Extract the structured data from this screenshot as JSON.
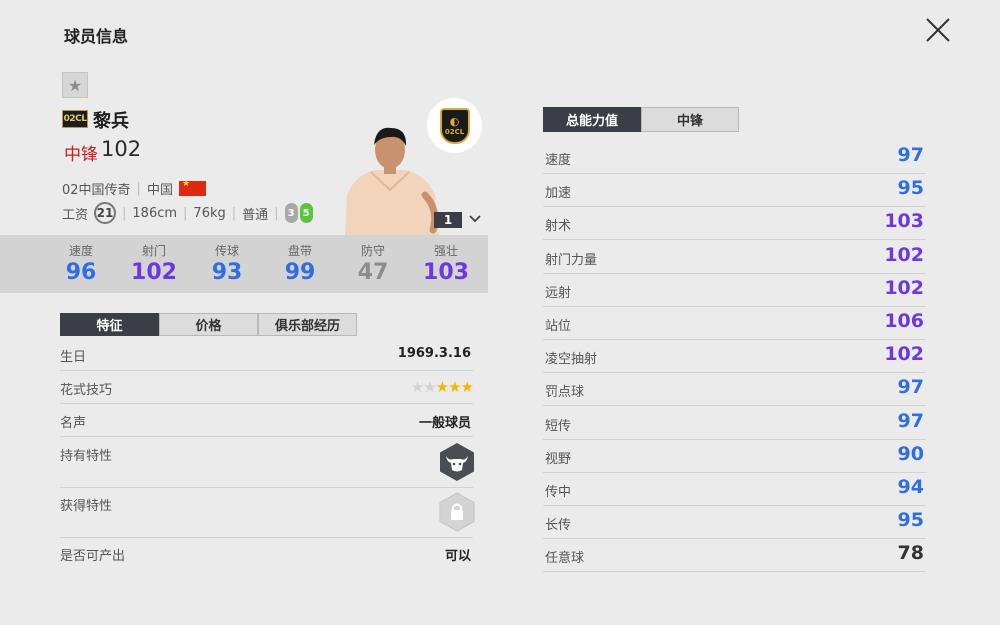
{
  "header": {
    "title": "球员信息",
    "close_icon": "close-icon"
  },
  "player": {
    "season_badge": "02CL",
    "name": "黎兵",
    "position": "中锋",
    "ovr": "102",
    "season": "02中国传奇",
    "nation": "中国",
    "salary_label": "工资",
    "salary": "21",
    "height": "186cm",
    "weight": "76kg",
    "body_type": "普通",
    "weak_foot": "3",
    "strong_foot": "5",
    "level": "1",
    "club_badge_text": "02CL"
  },
  "colors": {
    "blue": "#2f6fe0",
    "purple": "#6a3ae0",
    "gray": "#8c8c8c",
    "dark": "#333333",
    "red": "#c81e1e"
  },
  "summary_stats": [
    {
      "label": "速度",
      "value": "96",
      "color": "#2f6fe0"
    },
    {
      "label": "射门",
      "value": "102",
      "color": "#6a3ae0"
    },
    {
      "label": "传球",
      "value": "93",
      "color": "#2f6fe0"
    },
    {
      "label": "盘带",
      "value": "99",
      "color": "#2f6fe0"
    },
    {
      "label": "防守",
      "value": "47",
      "color": "#8c8c8c"
    },
    {
      "label": "强壮",
      "value": "103",
      "color": "#6a3ae0"
    }
  ],
  "left_tabs": [
    "特征",
    "价格",
    "俱乐部经历"
  ],
  "info": {
    "birthday_label": "生日",
    "birthday": "1969.3.16",
    "skill_label": "花式技巧",
    "skill_stars": 3,
    "skill_max": 5,
    "fame_label": "名声",
    "fame": "一般球员",
    "trait_label": "持有特性",
    "trait_icon": "buffalo-icon",
    "acquired_label": "获得特性",
    "acquired_icon": "lock-icon",
    "producible_label": "是否可产出",
    "producible": "可以"
  },
  "right_tabs": [
    "总能力值",
    "中锋"
  ],
  "attributes": [
    {
      "name": "速度",
      "value": "97",
      "color": "#2f6fe0"
    },
    {
      "name": "加速",
      "value": "95",
      "color": "#2f6fe0"
    },
    {
      "name": "射术",
      "value": "103",
      "color": "#6a3ae0"
    },
    {
      "name": "射门力量",
      "value": "102",
      "color": "#6a3ae0"
    },
    {
      "name": "远射",
      "value": "102",
      "color": "#6a3ae0"
    },
    {
      "name": "站位",
      "value": "106",
      "color": "#6a3ae0"
    },
    {
      "name": "凌空抽射",
      "value": "102",
      "color": "#6a3ae0"
    },
    {
      "name": "罚点球",
      "value": "97",
      "color": "#2f6fe0"
    },
    {
      "name": "短传",
      "value": "97",
      "color": "#2f6fe0"
    },
    {
      "name": "视野",
      "value": "90",
      "color": "#2f6fe0"
    },
    {
      "name": "传中",
      "value": "94",
      "color": "#2f6fe0"
    },
    {
      "name": "长传",
      "value": "95",
      "color": "#2f6fe0"
    },
    {
      "name": "任意球",
      "value": "78",
      "color": "#333333"
    }
  ]
}
